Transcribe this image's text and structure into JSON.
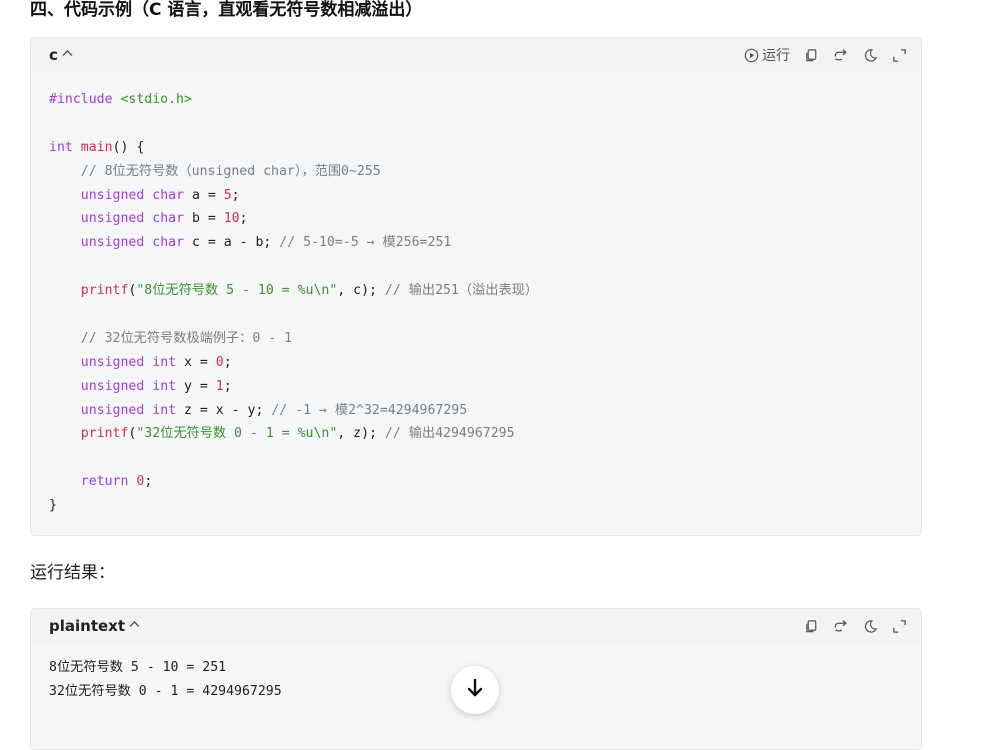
{
  "heading": "四、代码示例（C 语言，直观看无符号数相减溢出）",
  "code_block": {
    "language": "c",
    "run_label": "运行",
    "lines": [
      [
        {
          "t": "#include ",
          "c": "pp"
        },
        {
          "t": "<stdio.h>",
          "c": "inc"
        }
      ],
      [],
      [
        {
          "t": "int",
          "c": "kw"
        },
        {
          "t": " "
        },
        {
          "t": "main",
          "c": "fn"
        },
        {
          "t": "() {"
        }
      ],
      [
        {
          "t": "    // 8位无符号数（unsigned char），范围0~255",
          "c": "cm"
        }
      ],
      [
        {
          "t": "    "
        },
        {
          "t": "unsigned",
          "c": "kw"
        },
        {
          "t": " "
        },
        {
          "t": "char",
          "c": "kw"
        },
        {
          "t": " a = "
        },
        {
          "t": "5",
          "c": "num"
        },
        {
          "t": ";"
        }
      ],
      [
        {
          "t": "    "
        },
        {
          "t": "unsigned",
          "c": "kw"
        },
        {
          "t": " "
        },
        {
          "t": "char",
          "c": "kw"
        },
        {
          "t": " b = "
        },
        {
          "t": "10",
          "c": "num"
        },
        {
          "t": ";"
        }
      ],
      [
        {
          "t": "    "
        },
        {
          "t": "unsigned",
          "c": "kw"
        },
        {
          "t": " "
        },
        {
          "t": "char",
          "c": "kw"
        },
        {
          "t": " c = a - b; "
        },
        {
          "t": "// 5-10=-5 → 模256=251",
          "c": "cm"
        }
      ],
      [],
      [
        {
          "t": "    "
        },
        {
          "t": "printf",
          "c": "fn"
        },
        {
          "t": "("
        },
        {
          "t": "\"8位无符号数 5 - 10 = %u\\n\"",
          "c": "str"
        },
        {
          "t": ", c); "
        },
        {
          "t": "// 输出251（溢出表现）",
          "c": "cm"
        }
      ],
      [],
      [
        {
          "t": "    // 32位无符号数极端例子：0 - 1",
          "c": "cm"
        }
      ],
      [
        {
          "t": "    "
        },
        {
          "t": "unsigned",
          "c": "kw"
        },
        {
          "t": " "
        },
        {
          "t": "int",
          "c": "kw"
        },
        {
          "t": " x = "
        },
        {
          "t": "0",
          "c": "num"
        },
        {
          "t": ";"
        }
      ],
      [
        {
          "t": "    "
        },
        {
          "t": "unsigned",
          "c": "kw"
        },
        {
          "t": " "
        },
        {
          "t": "int",
          "c": "kw"
        },
        {
          "t": " y = "
        },
        {
          "t": "1",
          "c": "num"
        },
        {
          "t": ";"
        }
      ],
      [
        {
          "t": "    "
        },
        {
          "t": "unsigned",
          "c": "kw"
        },
        {
          "t": " "
        },
        {
          "t": "int",
          "c": "kw"
        },
        {
          "t": " z = x - y; "
        },
        {
          "t": "// -1 → 模2^32=4294967295",
          "c": "cm"
        }
      ],
      [
        {
          "t": "    "
        },
        {
          "t": "printf",
          "c": "fn"
        },
        {
          "t": "("
        },
        {
          "t": "\"32位无符号数 0 - 1 = %u\\n\"",
          "c": "str"
        },
        {
          "t": ", z); "
        },
        {
          "t": "// 输出4294967295",
          "c": "cm"
        }
      ],
      [],
      [
        {
          "t": "    "
        },
        {
          "t": "return",
          "c": "kw"
        },
        {
          "t": " "
        },
        {
          "t": "0",
          "c": "num"
        },
        {
          "t": ";"
        }
      ],
      [
        {
          "t": "}"
        }
      ]
    ]
  },
  "result_label": "运行结果：",
  "output_block": {
    "language": "plaintext",
    "lines": [
      [
        {
          "t": "8位无符号数 5 - 10 = 251"
        }
      ],
      [
        {
          "t": "32位无符号数 0 - 1 = 4294967295"
        }
      ]
    ]
  },
  "icons": [
    "play-circle-icon",
    "copy-icon",
    "share-icon",
    "theme-moon-icon",
    "expand-icon",
    "chevron-up-icon",
    "arrow-down-icon"
  ],
  "colors": {
    "keyword": "#a23ecf",
    "function": "#d12f4a",
    "string": "#39922b",
    "comment": "#7a7f86",
    "block_bg": "#f5f6f8"
  }
}
